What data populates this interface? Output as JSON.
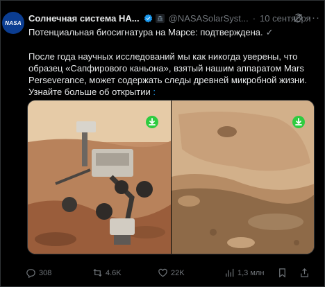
{
  "post": {
    "author_name": "Солнечная система НА...",
    "handle": "@NASASolarSyst...",
    "separator": "·",
    "date": "10 сентября",
    "avatar_text": "NASA",
    "headline": "Потенциальная биосигнатура на Марсе: подтверждена.",
    "headline_mark": "✓",
    "body_text": "После года научных исследований мы как никогда уверены, что образец «Сапфирового каньона», взятый нашим аппаратом Mars Perseverance, может содержать следы древней микробной жизни. Узнайте больше об открытии",
    "body_link_arrow": ":",
    "more_icon": "···"
  },
  "media": {
    "images": [
      {
        "name": "perseverance-rover-selfie",
        "icon": "download-icon"
      },
      {
        "name": "sapphire-canyon-rock",
        "icon": "download-icon"
      }
    ]
  },
  "actions": {
    "replies": "308",
    "reposts": "4.6K",
    "likes": "22K",
    "views": "1,3 млн"
  },
  "colors": {
    "background": "#000000",
    "text": "#e7e9ea",
    "muted": "#71767b",
    "link": "#1d9bf0",
    "verified": "#1d9bf0",
    "download_badge": "#2ecc40"
  }
}
